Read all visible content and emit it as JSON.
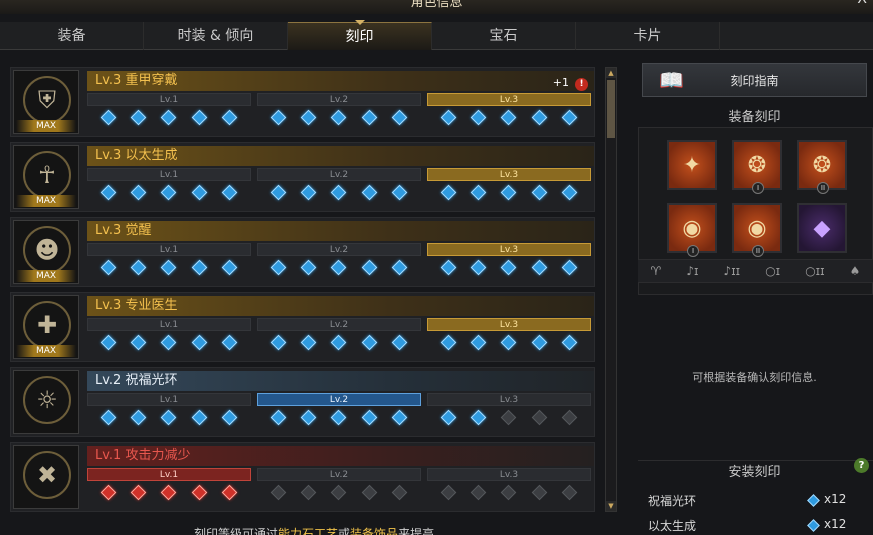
{
  "window": {
    "title": "角色信息",
    "close": "X"
  },
  "tabs": [
    {
      "label": "装备"
    },
    {
      "label": "时装 & 倾向"
    },
    {
      "label": "刻印"
    },
    {
      "label": "宝石"
    },
    {
      "label": "卡片"
    }
  ],
  "engravings": [
    {
      "name": "Lv.3 重甲穿戴",
      "max": "MAX",
      "badge": "+1",
      "badge_icon": "!",
      "style": "gold",
      "active_level": 3,
      "icon": "armor-knight-icon",
      "segments": [
        "Lv.1",
        "Lv.2",
        "Lv.3"
      ],
      "filled": 15
    },
    {
      "name": "Lv.3 以太生成",
      "max": "MAX",
      "style": "gold",
      "active_level": 3,
      "icon": "ether-figure-icon",
      "segments": [
        "Lv.1",
        "Lv.2",
        "Lv.3"
      ],
      "filled": 15
    },
    {
      "name": "Lv.3 觉醒",
      "max": "MAX",
      "style": "gold",
      "active_level": 3,
      "icon": "awakening-face-icon",
      "segments": [
        "Lv.1",
        "Lv.2",
        "Lv.3"
      ],
      "filled": 15
    },
    {
      "name": "Lv.3 专业医生",
      "max": "MAX",
      "style": "gold",
      "active_level": 3,
      "icon": "doctor-icon",
      "segments": [
        "Lv.1",
        "Lv.2",
        "Lv.3"
      ],
      "filled": 15
    },
    {
      "name": "Lv.2 祝福光环",
      "max": "",
      "style": "blue",
      "active_level": 2,
      "icon": "blessing-aura-icon",
      "segments": [
        "Lv.1",
        "Lv.2",
        "Lv.3"
      ],
      "filled": 12
    },
    {
      "name": "Lv.1 攻击力减少",
      "max": "",
      "style": "red",
      "active_level": 1,
      "icon": "attack-reduction-icon",
      "segments": [
        "Lv.1",
        "Lv.2",
        "Lv.3"
      ],
      "filled": 5
    }
  ],
  "footer": {
    "prefix": "刻印等级可通过",
    "hl1": "能力石工艺",
    "mid": "或",
    "hl2": "装备饰品",
    "suffix": "来提高"
  },
  "right_panel": {
    "guide_button": "刻印指南",
    "equip_title": "装备刻印",
    "equip_slots": [
      {
        "icon": "necklace-icon",
        "num": ""
      },
      {
        "icon": "earring-icon",
        "num": "I"
      },
      {
        "icon": "earring-icon",
        "num": "II"
      },
      {
        "icon": "ring-icon",
        "num": "I"
      },
      {
        "icon": "ring-icon",
        "num": "II"
      },
      {
        "icon": "ability-stone-icon",
        "num": ""
      }
    ],
    "info_text": "可根据装备确认刻印信息.",
    "install_title": "安装刻印",
    "help": "?",
    "installed": [
      {
        "name": "祝福光环",
        "count": "x12"
      },
      {
        "name": "以太生成",
        "count": "x12"
      }
    ]
  },
  "colors": {
    "gold": "#f3c04e",
    "blue_gem": "#2f9be0",
    "red": "#e8574e"
  }
}
